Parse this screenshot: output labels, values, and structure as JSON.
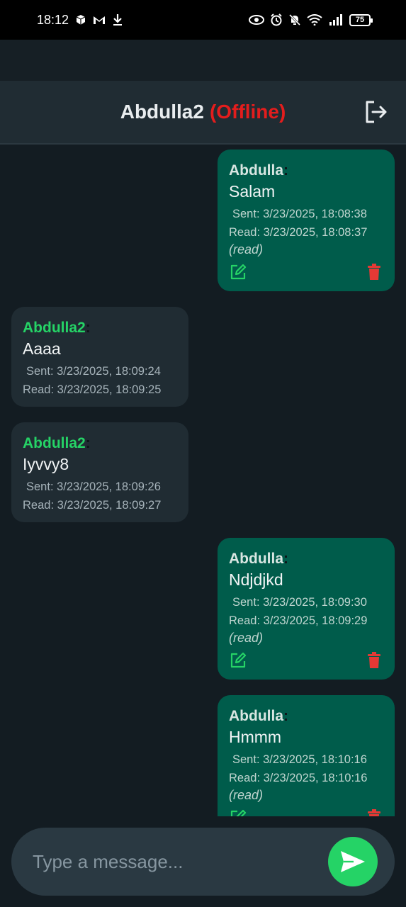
{
  "status_bar": {
    "time": "18:12",
    "battery": "75"
  },
  "header": {
    "contact_name": "Abdulla2",
    "presence": "(Offline)"
  },
  "colors": {
    "outgoing_bubble": "#005c4b",
    "incoming_bubble": "#202c33",
    "incoming_sender": "#25d366",
    "offline": "#e31d1d",
    "delete": "#e53935",
    "edit": "#25d366"
  },
  "messages": [
    {
      "direction": "out",
      "sender": "Abdulla",
      "colon": ":",
      "text": "Salam",
      "sent": "Sent: 3/23/2025, 18:08:38",
      "read": "Read: 3/23/2025, 18:08:37",
      "read_flag": "(read)"
    },
    {
      "direction": "in",
      "sender": "Abdulla2",
      "colon": ":",
      "text": "Aaaa",
      "sent": "Sent: 3/23/2025, 18:09:24",
      "read": "Read: 3/23/2025, 18:09:25"
    },
    {
      "direction": "in",
      "sender": "Abdulla2",
      "colon": ":",
      "text": "Iyvvy8",
      "sent": "Sent: 3/23/2025, 18:09:26",
      "read": "Read: 3/23/2025, 18:09:27"
    },
    {
      "direction": "out",
      "sender": "Abdulla",
      "colon": ":",
      "text": "Ndjdjkd",
      "sent": "Sent: 3/23/2025, 18:09:30",
      "read": "Read: 3/23/2025, 18:09:29",
      "read_flag": "(read)"
    },
    {
      "direction": "out",
      "sender": "Abdulla",
      "colon": ":",
      "text": "Hmmm",
      "sent": "Sent: 3/23/2025, 18:10:16",
      "read": "Read: 3/23/2025, 18:10:16",
      "read_flag": "(read)"
    }
  ],
  "composer": {
    "placeholder": "Type a message..."
  },
  "icons": {
    "logout": "logout-icon",
    "edit": "edit-icon",
    "delete": "trash-icon",
    "send": "send-icon"
  }
}
